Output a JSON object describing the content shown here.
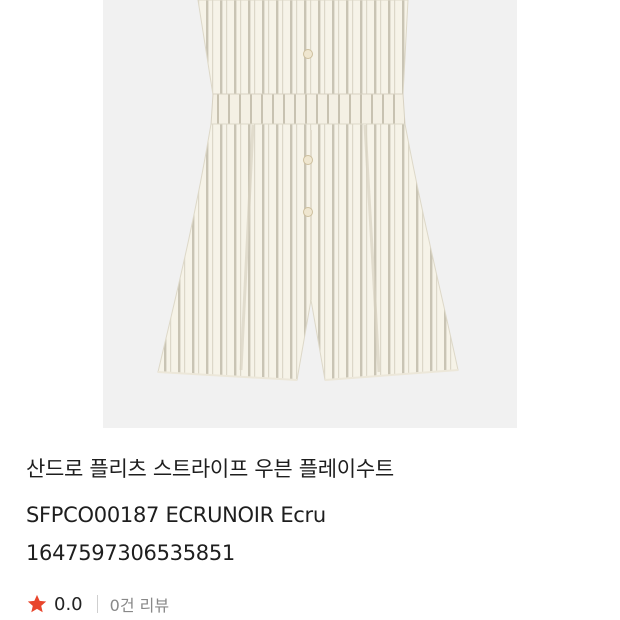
{
  "product": {
    "image_alt": "striped ecru playsuit",
    "name_line1": "산드로 플리츠 스트라이프 우븐 플레이수트",
    "name_line2": "SFPCO00187 ECRUNOIR Ecru",
    "name_line3": "1647597306535851"
  },
  "rating": {
    "star_icon": "star-icon",
    "star_color": "#e8452c",
    "value": "0.0",
    "review_count": "0건 리뷰"
  },
  "colors": {
    "image_background": "#f1f1f1",
    "fabric": "#f6f3e8",
    "stripe": "#c9c4b4"
  }
}
